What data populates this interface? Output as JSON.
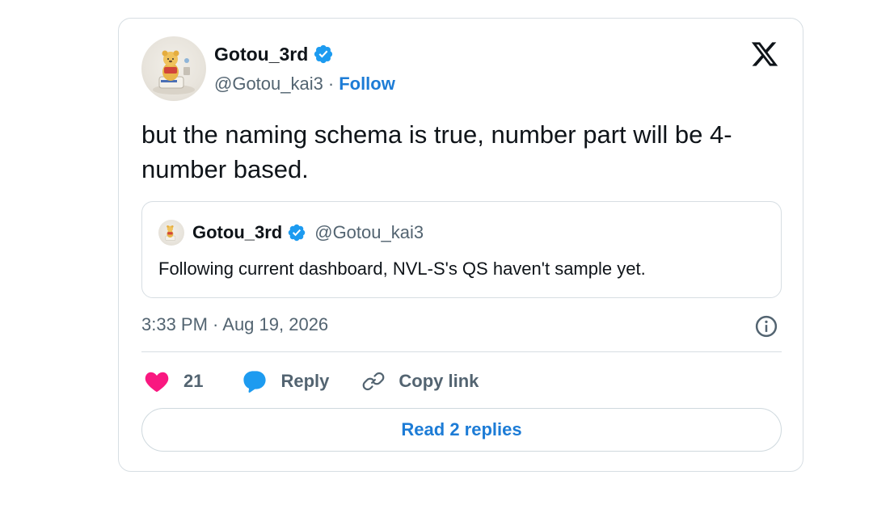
{
  "tweet": {
    "author": {
      "display_name": "Gotou_3rd",
      "handle": "@Gotou_kai3",
      "separator": "·",
      "follow_label": "Follow",
      "avatar_icon": "winnie-the-pooh-avatar",
      "verified_icon": "verified-badge-icon"
    },
    "text": "but the naming schema is true, number part will be 4-number based.",
    "quote": {
      "display_name": "Gotou_3rd",
      "handle": "@Gotou_kai3",
      "text": "Following current dashboard, NVL-S's QS haven't sample yet."
    },
    "timestamp": "3:33 PM · Aug 19, 2026",
    "actions": {
      "like_count": "21",
      "reply_label": "Reply",
      "copy_link_label": "Copy link"
    },
    "read_replies_label": "Read 2 replies"
  },
  "colors": {
    "link_blue": "#1d7cd6",
    "verified_blue": "#1d9bf0",
    "like_pink": "#f91880",
    "reply_blue": "#1d9bf0",
    "secondary_text": "#536471",
    "border": "#d7dee3"
  }
}
